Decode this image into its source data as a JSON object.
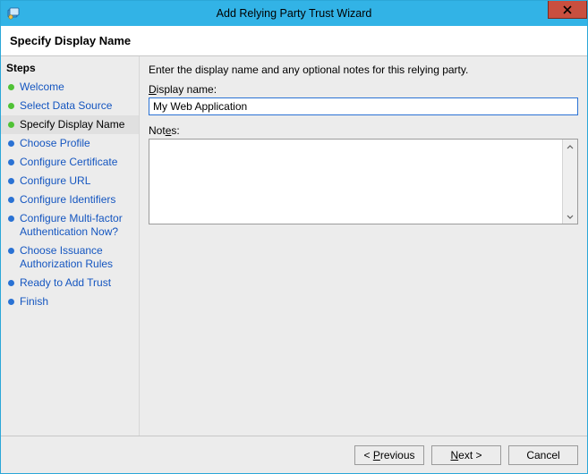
{
  "window": {
    "title": "Add Relying Party Trust Wizard"
  },
  "header": {
    "title": "Specify Display Name"
  },
  "sidebar": {
    "title": "Steps",
    "items": [
      {
        "label": "Welcome",
        "state": "done"
      },
      {
        "label": "Select Data Source",
        "state": "done"
      },
      {
        "label": "Specify Display Name",
        "state": "current"
      },
      {
        "label": "Choose Profile",
        "state": "pending"
      },
      {
        "label": "Configure Certificate",
        "state": "pending"
      },
      {
        "label": "Configure URL",
        "state": "pending"
      },
      {
        "label": "Configure Identifiers",
        "state": "pending"
      },
      {
        "label": "Configure Multi-factor Authentication Now?",
        "state": "pending"
      },
      {
        "label": "Choose Issuance Authorization Rules",
        "state": "pending"
      },
      {
        "label": "Ready to Add Trust",
        "state": "pending"
      },
      {
        "label": "Finish",
        "state": "pending"
      }
    ]
  },
  "main": {
    "instruction": "Enter the display name and any optional notes for this relying party.",
    "display_name_label_pre": "D",
    "display_name_label_rest": "isplay name:",
    "display_name_value": "My Web Application",
    "notes_label_pre": "Not",
    "notes_label_ul": "e",
    "notes_label_post": "s:",
    "notes_value": ""
  },
  "footer": {
    "previous_pre": "< ",
    "previous_ul": "P",
    "previous_post": "revious",
    "next_ul": "N",
    "next_post": "ext >",
    "cancel": "Cancel"
  }
}
